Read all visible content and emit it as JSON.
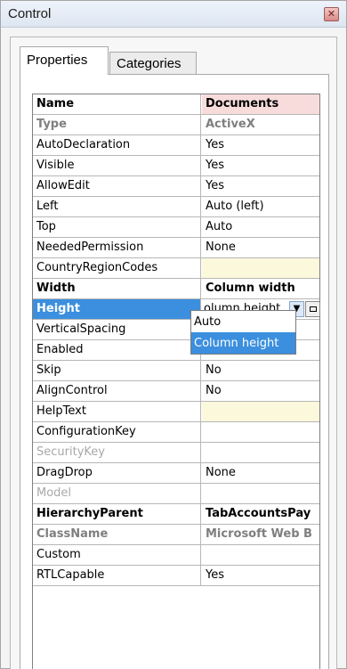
{
  "window": {
    "title": "Control",
    "close_glyph": "✕"
  },
  "tabs": [
    {
      "label": "Properties"
    },
    {
      "label": "Categories"
    }
  ],
  "properties": [
    {
      "name": "Name",
      "value": "Documents"
    },
    {
      "name": "Type",
      "value": "ActiveX"
    },
    {
      "name": "AutoDeclaration",
      "value": "Yes"
    },
    {
      "name": "Visible",
      "value": "Yes"
    },
    {
      "name": "AllowEdit",
      "value": "Yes"
    },
    {
      "name": "Left",
      "value": "Auto (left)"
    },
    {
      "name": "Top",
      "value": "Auto"
    },
    {
      "name": "NeededPermission",
      "value": "None"
    },
    {
      "name": "CountryRegionCodes",
      "value": ""
    },
    {
      "name": "Width",
      "value": "Column width"
    },
    {
      "name": "Height",
      "value": "Column height"
    },
    {
      "name": "VerticalSpacing",
      "value": ""
    },
    {
      "name": "Enabled",
      "value": ""
    },
    {
      "name": "Skip",
      "value": "No"
    },
    {
      "name": "AlignControl",
      "value": "No"
    },
    {
      "name": "HelpText",
      "value": ""
    },
    {
      "name": "ConfigurationKey",
      "value": ""
    },
    {
      "name": "SecurityKey",
      "value": ""
    },
    {
      "name": "DragDrop",
      "value": "None"
    },
    {
      "name": "Model",
      "value": ""
    },
    {
      "name": "HierarchyParent",
      "value": "TabAccountsPay"
    },
    {
      "name": "ClassName",
      "value": "Microsoft Web B"
    },
    {
      "name": "Custom",
      "value": ""
    },
    {
      "name": "RTLCapable",
      "value": "Yes"
    }
  ],
  "height_editor": {
    "visible_text": "olumn height",
    "dropdown_arrow": "▼",
    "options": [
      "Auto",
      "Column height"
    ],
    "selected": "Column height"
  },
  "colors": {
    "selection": "#3b8fde",
    "name_header_bg": "#f8dcdc",
    "empty_value_bg": "#fbf8dc"
  }
}
